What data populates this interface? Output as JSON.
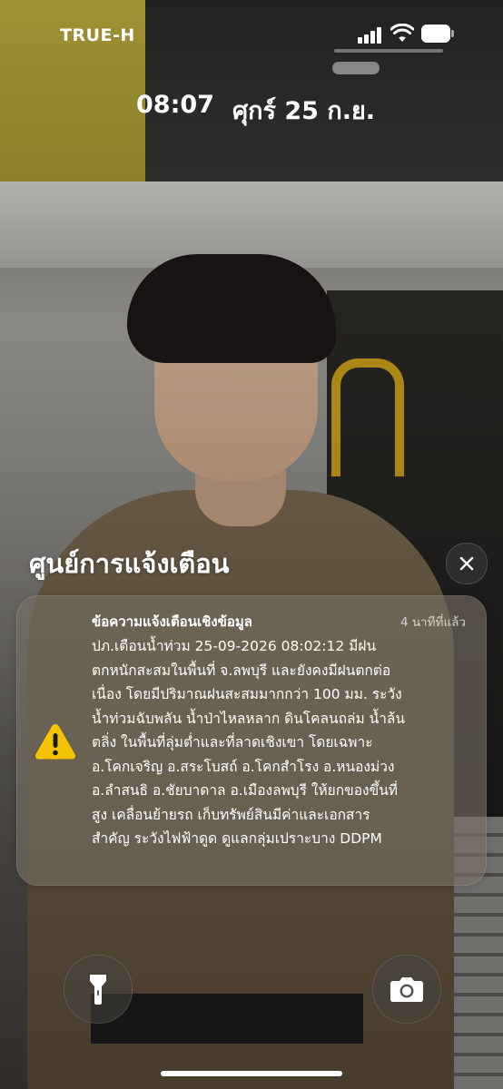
{
  "status_bar": {
    "carrier": "TRUE-H",
    "icons": [
      "signal-icon",
      "wifi-icon",
      "battery-icon"
    ]
  },
  "lock_screen": {
    "time": "08:07",
    "date": "ศุกร์ 25 ก.ย."
  },
  "notification_center": {
    "title": "ศูนย์การแจ้งเตือน",
    "clear_icon": "close-icon",
    "notification": {
      "icon": "warning-icon",
      "title": "ข้อความแจ้งเตือนเชิงข้อมูล",
      "time_ago": "4 นาทีที่แล้ว",
      "body_lines": [
        "ปภ.เตือนน้ำท่วม  25-09-2026 08:02:12 มีฝน",
        "ตกหนักสะสมในพื้นที่ จ.ลพบุรี และยังคงมีฝนตกต่อ",
        "เนื่อง โดยมีปริมาณฝนสะสมมากกว่า 100 มม. ระวัง",
        "น้ำท่วมฉับพลัน น้ำป่าไหลหลาก ดินโคลนถล่ม น้ำล้น",
        "ตลิ่ง ในพื้นที่ลุ่มต่ำและที่ลาดเชิงเขา โดยเฉพาะ",
        "อ.โคกเจริญ อ.สระโบสถ์ อ.โคกสำโรง อ.หนองม่วง",
        "อ.ลำสนธิ อ.ชัยบาดาล อ.เมืองลพบุรี ให้ยกของขึ้นที่",
        "สูง เคลื่อนย้ายรถ เก็บทรัพย์สินมีค่าและเอกสาร",
        "สำคัญ ระวังไฟฟ้าดูด ดูแลกลุ่มเปราะบาง DDPM"
      ],
      "accent_color": "#F5C400"
    }
  },
  "bottom_controls": {
    "left_icon": "flashlight-icon",
    "right_icon": "camera-icon"
  }
}
